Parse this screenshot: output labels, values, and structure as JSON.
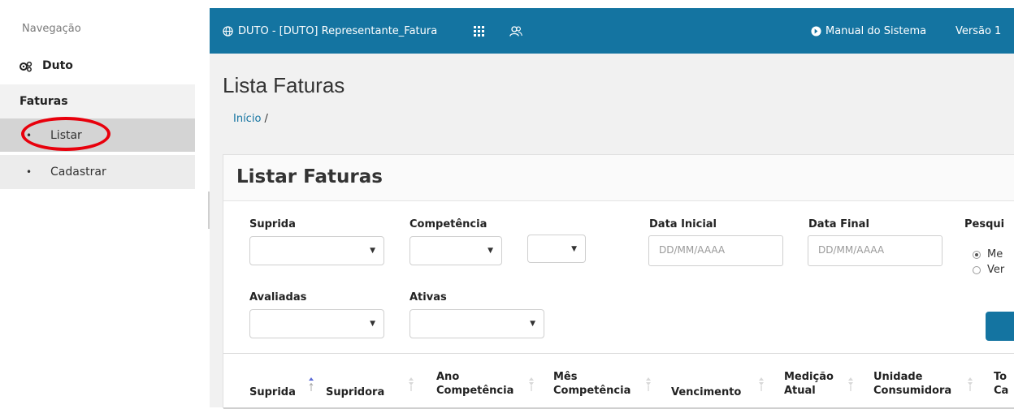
{
  "sidebar": {
    "heading": "Navegação",
    "duto_label": "Duto",
    "faturas_label": "Faturas",
    "items": [
      {
        "bullet": "•",
        "label": "Listar"
      },
      {
        "bullet": "•",
        "label": "Cadastrar"
      }
    ]
  },
  "topbar": {
    "brand": "DUTO - [DUTO] Representante_Fatura",
    "manual": "Manual do Sistema",
    "version": "Versão 1",
    "color": "#1474a1"
  },
  "page": {
    "title": "Lista Faturas",
    "breadcrumb_home": "Início",
    "breadcrumb_sep": " /"
  },
  "panel": {
    "title": "Listar Faturas"
  },
  "filters": {
    "suprida": "Suprida",
    "competencia": "Competência",
    "data_inicial": "Data Inicial",
    "data_final": "Data Final",
    "pesquisa": "Pesqui",
    "date_placeholder": "DD/MM/AAAA",
    "radio1": "Me",
    "radio2": "Ver",
    "avaliadas": "Avaliadas",
    "ativas": "Ativas"
  },
  "table": {
    "headers": [
      {
        "l1": "Suprida",
        "l2": ""
      },
      {
        "l1": "Supridora",
        "l2": ""
      },
      {
        "l1": "Ano",
        "l2": "Competência"
      },
      {
        "l1": "Mês",
        "l2": "Competência"
      },
      {
        "l1": "Vencimento",
        "l2": ""
      },
      {
        "l1": "Medição",
        "l2": "Atual"
      },
      {
        "l1": "Unidade",
        "l2": "Consumidora"
      },
      {
        "l1": "To",
        "l2": "Ca"
      }
    ]
  }
}
